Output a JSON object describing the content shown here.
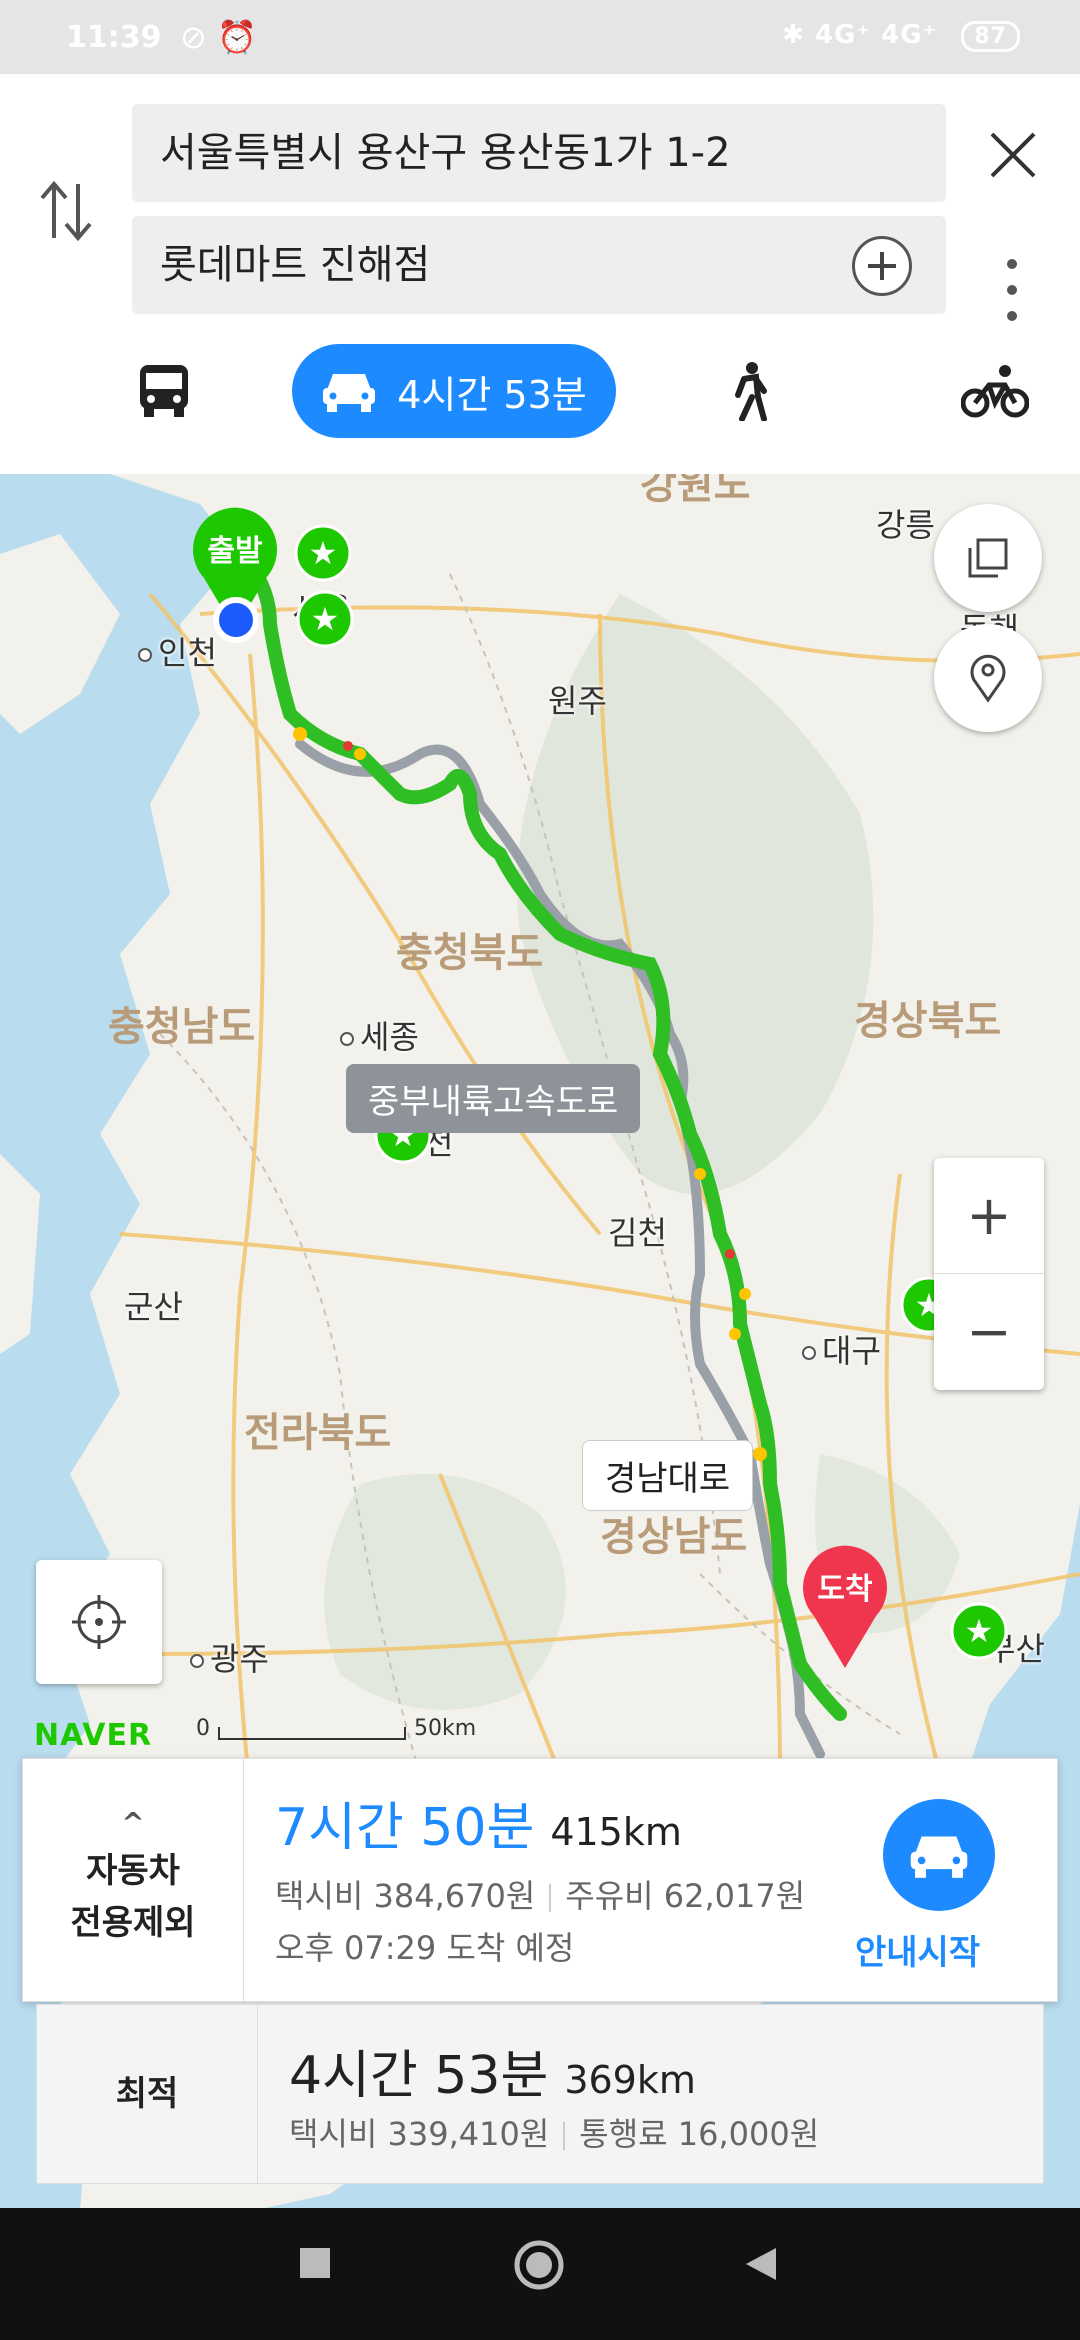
{
  "status_bar": {
    "time": "11:39",
    "network": "4G⁺ 4G⁺",
    "battery": "87"
  },
  "route_inputs": {
    "origin": "서울특별시 용산구 용산동1가 1-2",
    "destination": "롯데마트 진해점"
  },
  "modes": {
    "car_label": "4시간 53분"
  },
  "map": {
    "regions": [
      "강원도",
      "충청북도",
      "충청남도",
      "경상북도",
      "전라북도",
      "경상남도"
    ],
    "cities": [
      "인천",
      "원주",
      "세종",
      "김천",
      "군산",
      "대구",
      "광주",
      "부산",
      "강릉",
      "동해",
      "서울",
      "천"
    ],
    "road_tags": [
      "중부내륙고속도로",
      "경남대로"
    ],
    "origin_pin": "출발",
    "dest_pin": "도착",
    "logo": "NAVER",
    "scale_start": "0",
    "scale_end": "50km"
  },
  "routes": [
    {
      "type_label": "자동차\n전용제외",
      "duration": "7시간 50분",
      "distance": "415km",
      "taxi": "택시비 384,670원",
      "fuel": "주유비 62,017원",
      "arrival": "오후 07:29 도착 예정",
      "start_label": "안내시작"
    },
    {
      "type_label": "최적",
      "duration": "4시간 53분",
      "distance": "369km",
      "taxi": "택시비 339,410원",
      "toll": "통행료 16,000원"
    }
  ]
}
